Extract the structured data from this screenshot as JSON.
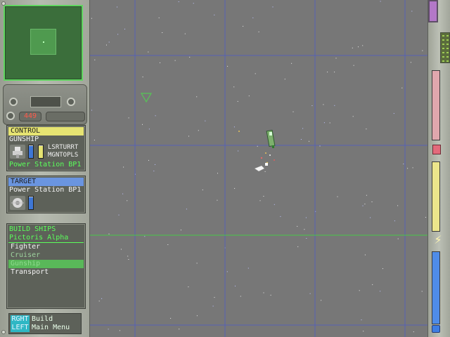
{
  "hud": {
    "credits": "449"
  },
  "control": {
    "header": "CONTROL",
    "unit_type": "GUNSHIP",
    "weapon_1": "LSRTURRT",
    "weapon_2": "MGNTOPLS",
    "location": "Power Station BP1",
    "health_level": 0.95,
    "energy_level": 0.95
  },
  "target": {
    "header": "TARGET",
    "name": "Power Station BP1",
    "health_level": 0.95
  },
  "build": {
    "title": "BUILD SHIPS",
    "faction": "Pictoris Alpha",
    "items": [
      {
        "label": "Fighter",
        "state": "normal"
      },
      {
        "label": "Cruiser",
        "state": "dim"
      },
      {
        "label": "Gunship",
        "state": "selected"
      },
      {
        "label": "Transport",
        "state": "normal"
      }
    ]
  },
  "help": {
    "right_key": "RGHT",
    "right_action": "Build",
    "left_key": "LEFT",
    "left_action": "Main Menu"
  },
  "gauges": {
    "health_level": 1.0,
    "energy_level": 1.0,
    "shield_level": 1.0
  },
  "colors": {
    "control_header": "#e6e472",
    "target_header": "#6a95e0",
    "build_selected": "#59b859",
    "minimap_border": "#5fd65f",
    "grid_blue": "#4a5acf",
    "grid_green": "#43d043"
  }
}
